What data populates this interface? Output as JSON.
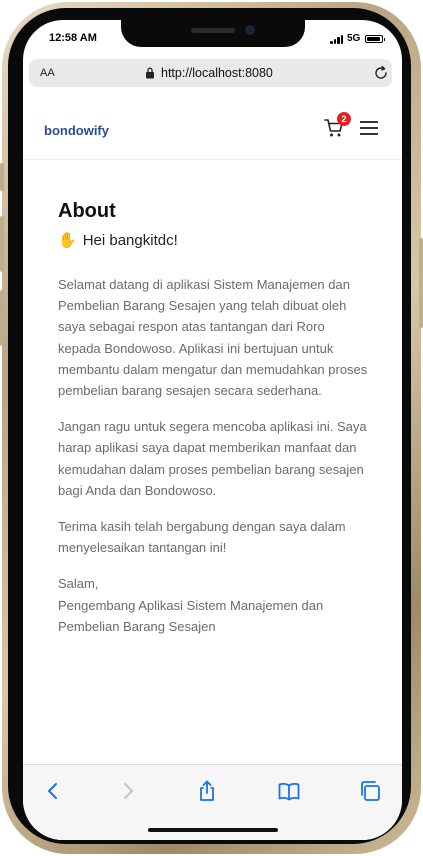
{
  "status_bar": {
    "time": "12:58 AM",
    "network": "5G"
  },
  "browser": {
    "text_size_label": "AA",
    "url": "http://localhost:8080"
  },
  "navbar": {
    "brand": "bondowify",
    "cart_count": "2"
  },
  "about": {
    "title": "About",
    "greeting_emoji": "✋",
    "greeting": "Hei bangkitdc!",
    "paragraphs": [
      "Selamat datang di aplikasi Sistem Manajemen dan Pembelian Barang Sesajen yang telah dibuat oleh saya sebagai respon atas tantangan dari Roro kepada Bondowoso. Aplikasi ini bertujuan untuk membantu dalam mengatur dan memudahkan proses pembelian barang sesajen secara sederhana.",
      "Jangan ragu untuk segera mencoba aplikasi ini. Saya harap aplikasi saya dapat memberikan manfaat dan kemudahan dalam proses pembelian barang sesajen bagi Anda dan Bondowoso.",
      "Terima kasih telah bergabung dengan saya dalam menyelesaikan tantangan ini!"
    ],
    "closing_salutation": "Salam,",
    "closing_signature": "Pengembang Aplikasi Sistem Manajemen dan Pembelian Barang Sesajen"
  },
  "colors": {
    "brand": "#2c4a9a",
    "ios_blue": "#1a73e8",
    "badge": "#e02424",
    "body_text": "#6b6b6b"
  },
  "icons": {
    "lock": "lock-icon",
    "reload": "reload-icon",
    "cart": "cart-icon",
    "menu": "hamburger-menu-icon",
    "back": "chevron-left-icon",
    "forward": "chevron-right-icon",
    "share": "share-icon",
    "bookmarks": "book-icon",
    "tabs": "tabs-icon"
  }
}
